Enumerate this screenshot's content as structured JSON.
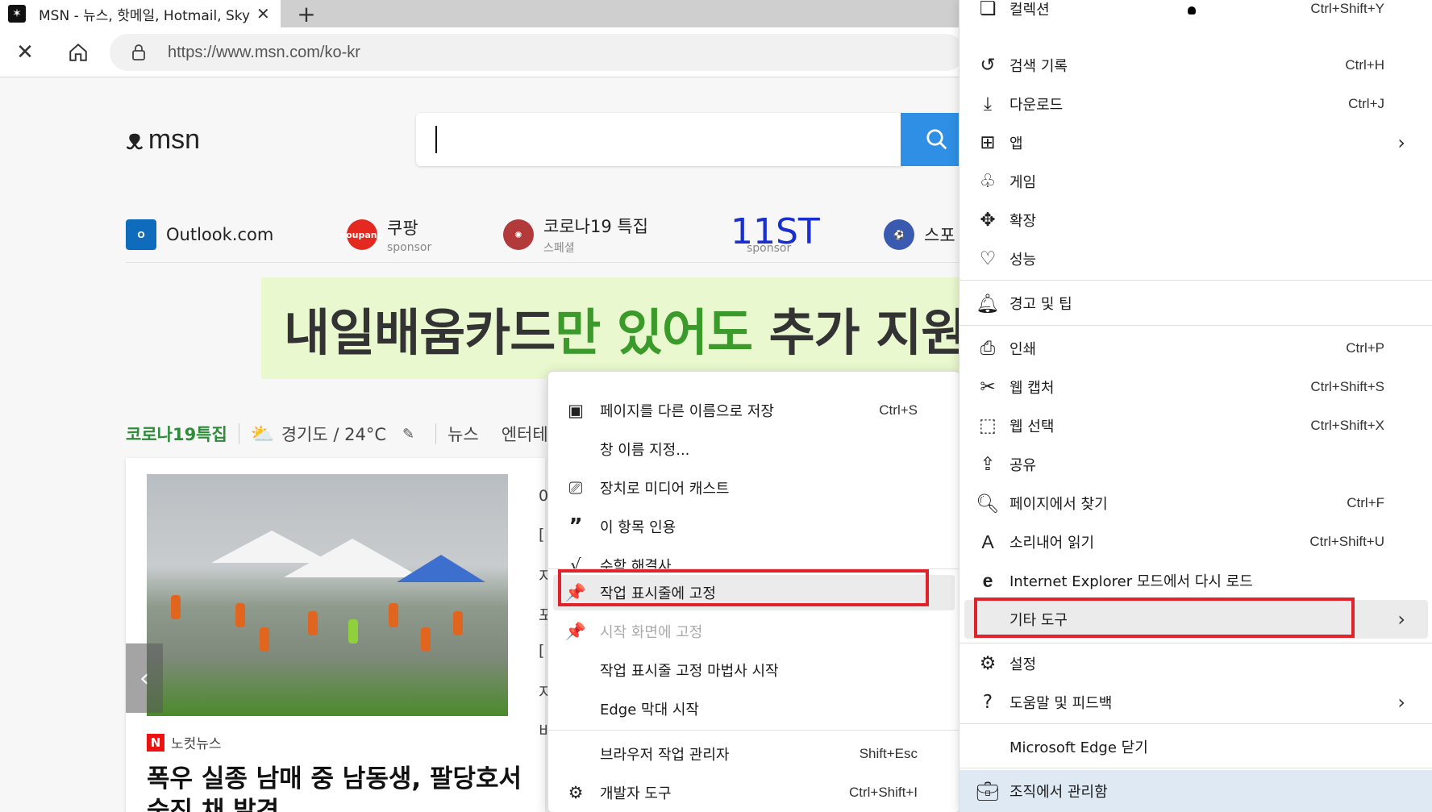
{
  "browser": {
    "tab_title": "MSN - 뉴스, 핫메일, Hotmail, Skype",
    "new_tab": "+",
    "url": "https://www.msn.com/ko-kr"
  },
  "page": {
    "logo_text": "msn",
    "quicklinks": [
      {
        "label": "Outlook.com",
        "sub": ""
      },
      {
        "label": "쿠팡",
        "sub": "sponsor"
      },
      {
        "label": "코로나19 특집",
        "sub": "스페셜"
      },
      {
        "label": "11ST",
        "sub": "sponsor"
      },
      {
        "label": "스포",
        "sub": ""
      }
    ],
    "banner": {
      "part1": "내일배움카드",
      "part2": "만 있어도",
      "part3": " 추가 지원금"
    },
    "nav": {
      "covid": "코로나19특집",
      "weather": "경기도 / 24°C",
      "news": "뉴스",
      "entertainment": "엔터테"
    },
    "card": {
      "source": "노컷뉴스",
      "headline": "폭우 실종 남매 중 남동생, 팔당호서 숨진 채 발견"
    },
    "side_list": [
      "0",
      "[",
      "지",
      "포",
      "[",
      "지",
      "비"
    ]
  },
  "context_menu": [
    {
      "label": "페이지를 다른 이름으로 저장",
      "shortcut": "Ctrl+S",
      "icon": "save-as-icon"
    },
    {
      "label": "창 이름 지정...",
      "shortcut": "",
      "icon": ""
    },
    {
      "label": "장치로 미디어 캐스트",
      "shortcut": "",
      "icon": "cast-icon"
    },
    {
      "label": "이 항목 인용",
      "shortcut": "",
      "icon": "quote-icon"
    },
    {
      "label": "수학 해결사",
      "shortcut": "",
      "icon": "math-solver-icon"
    },
    {
      "label": "작업 표시줄에 고정",
      "shortcut": "",
      "icon": "pin-icon"
    },
    {
      "label": "시작 화면에 고정",
      "shortcut": "",
      "icon": "pin-icon"
    },
    {
      "label": "작업 표시줄 고정 마법사 시작",
      "shortcut": "",
      "icon": ""
    },
    {
      "label": "Edge 막대 시작",
      "shortcut": "",
      "icon": ""
    },
    {
      "label": "브라우저 작업 관리자",
      "shortcut": "Shift+Esc",
      "icon": ""
    },
    {
      "label": "개발자 도구",
      "shortcut": "Ctrl+Shift+I",
      "icon": "developer-tools-icon"
    }
  ],
  "edge_menu": [
    {
      "label": "컬렉션",
      "shortcut": "Ctrl+Shift+Y"
    },
    {
      "label": "검색 기록",
      "shortcut": "Ctrl+H"
    },
    {
      "label": "다운로드",
      "shortcut": "Ctrl+J"
    },
    {
      "label": "앱",
      "shortcut": ""
    },
    {
      "label": "게임",
      "shortcut": ""
    },
    {
      "label": "확장",
      "shortcut": ""
    },
    {
      "label": "성능",
      "shortcut": ""
    },
    {
      "label": "경고 및 팁",
      "shortcut": ""
    },
    {
      "label": "인쇄",
      "shortcut": "Ctrl+P"
    },
    {
      "label": "웹 캡처",
      "shortcut": "Ctrl+Shift+S"
    },
    {
      "label": "웹 선택",
      "shortcut": "Ctrl+Shift+X"
    },
    {
      "label": "공유",
      "shortcut": ""
    },
    {
      "label": "페이지에서 찾기",
      "shortcut": "Ctrl+F"
    },
    {
      "label": "소리내어 읽기",
      "shortcut": "Ctrl+Shift+U"
    },
    {
      "label": "Internet Explorer 모드에서 다시 로드",
      "shortcut": ""
    },
    {
      "label": "기타 도구",
      "shortcut": ""
    },
    {
      "label": "설정",
      "shortcut": ""
    },
    {
      "label": "도움말 및 피드백",
      "shortcut": ""
    },
    {
      "label": "Microsoft Edge 닫기",
      "shortcut": ""
    },
    {
      "label": "조직에서 관리함",
      "shortcut": ""
    }
  ],
  "colors": {
    "highlight": "#e0232b",
    "search_button": "#2f8fe4",
    "managed_bg": "#dfe9f4"
  }
}
